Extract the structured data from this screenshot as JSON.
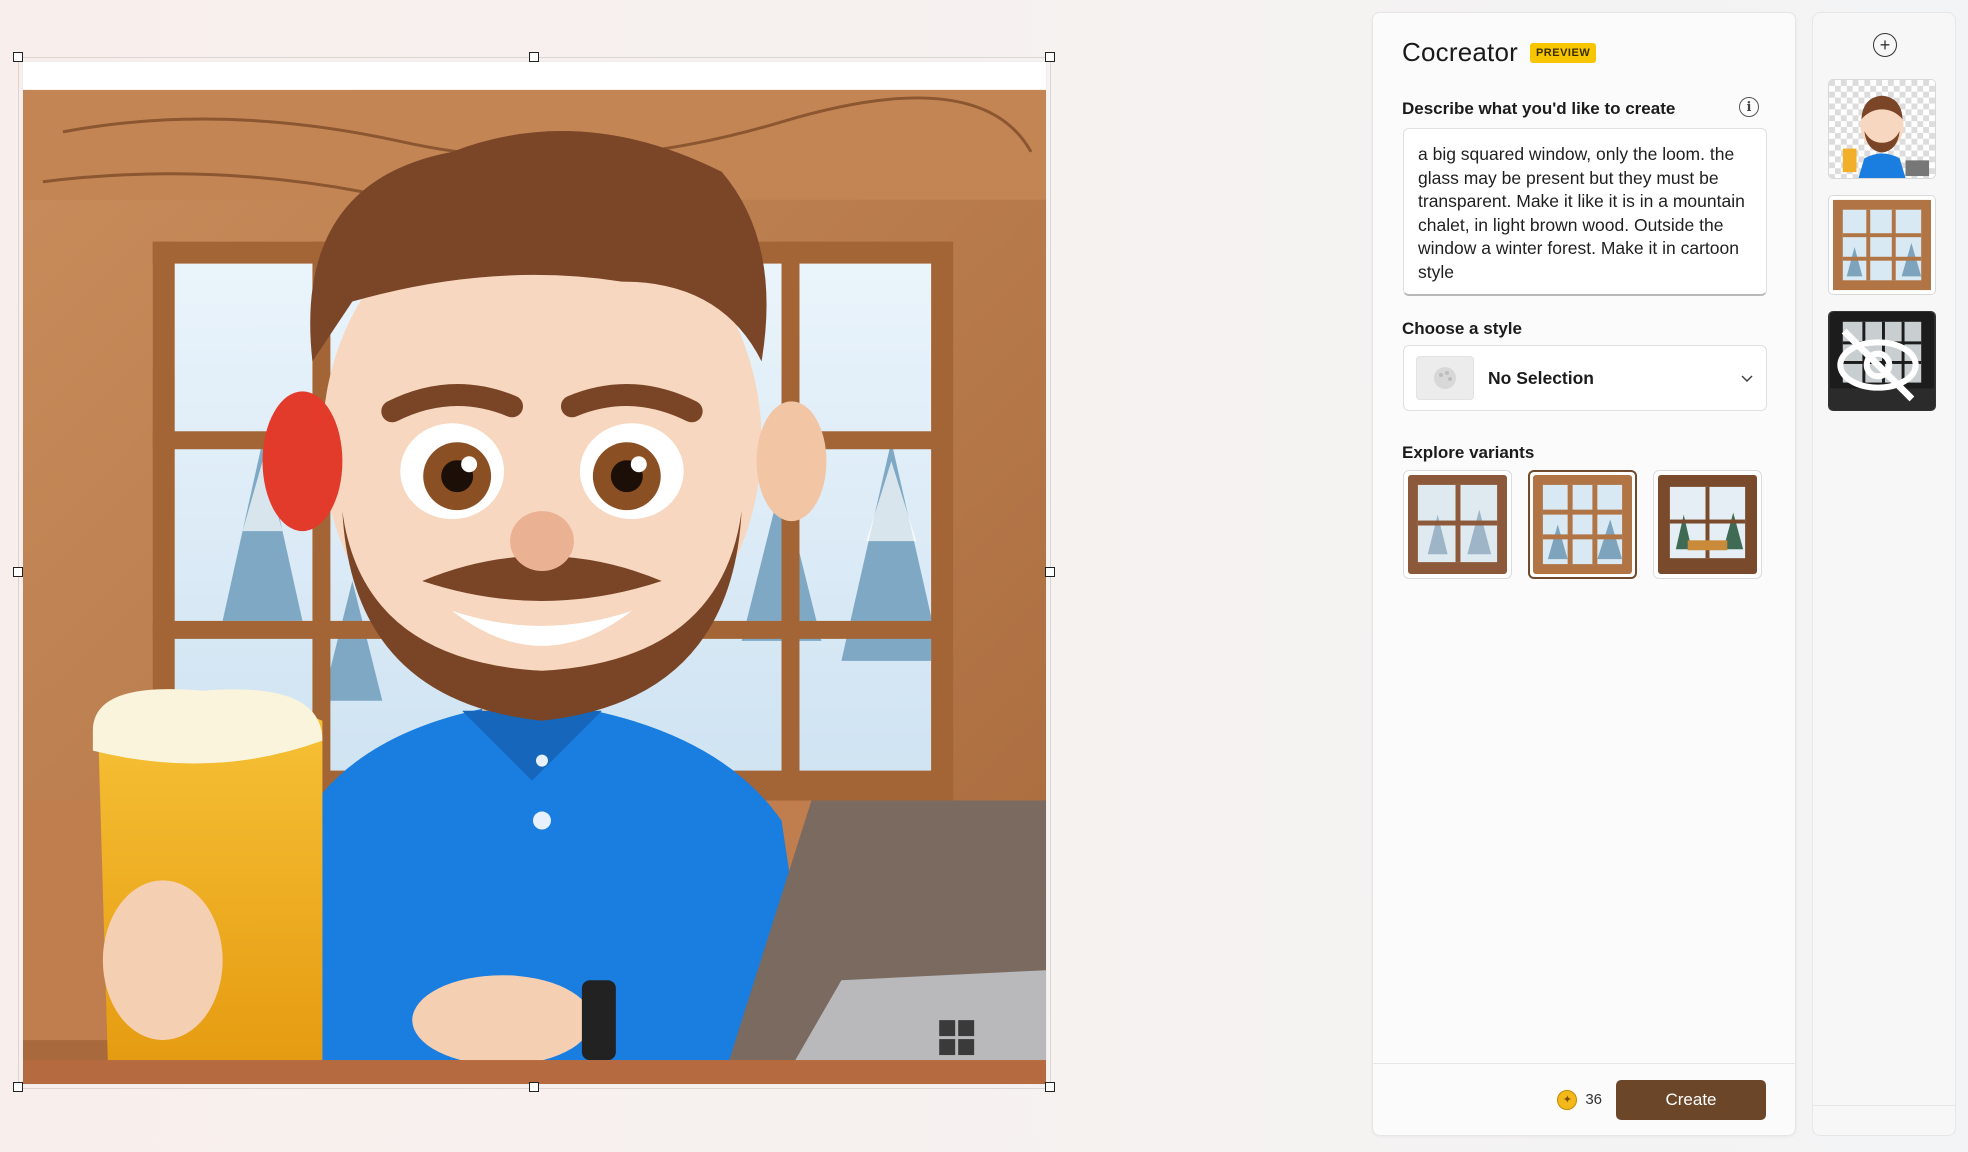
{
  "canvas": {
    "image_description_icon": "cartoon-man-with-beer-and-laptop-in-chalet-window"
  },
  "cocreator": {
    "title": "Cocreator",
    "badge": "PREVIEW",
    "describe_label": "Describe what you'd like to create",
    "prompt_text": "a big squared window, only the loom. the glass may be present but they must be transparent. Make it like it is in a mountain chalet, in light brown wood. Outside the window a winter forest. Make it in cartoon style",
    "style_label": "Choose a style",
    "style_value": "No Selection",
    "variants_label": "Explore variants",
    "variants": [
      {
        "icon": "window-variant-1"
      },
      {
        "icon": "window-variant-2"
      },
      {
        "icon": "window-variant-3"
      }
    ],
    "selected_variant": 2,
    "credits": "36",
    "create_label": "Create"
  },
  "colors": {
    "accent_brown": "#6c4629",
    "badge_yellow": "#f7c600"
  },
  "layers": {
    "add_icon": "plus-circle-icon",
    "items": [
      {
        "icon": "character-layer"
      },
      {
        "icon": "window-layer"
      },
      {
        "icon": "dark-window-layer-hidden"
      }
    ]
  }
}
